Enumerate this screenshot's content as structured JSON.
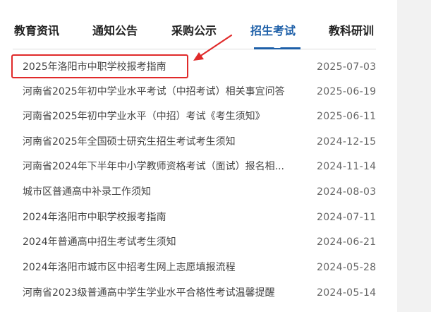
{
  "tabs": [
    {
      "label": "教育资讯"
    },
    {
      "label": "通知公告"
    },
    {
      "label": "采购公示"
    },
    {
      "label": "招生考试"
    },
    {
      "label": "教科研训"
    }
  ],
  "active_tab": "招生考试",
  "news": [
    {
      "title": "2025年洛阳市中职学校报考指南",
      "date": "2025-07-03"
    },
    {
      "title": "河南省2025年初中学业水平考试（中招考试）相关事宜问答",
      "date": "2025-06-19"
    },
    {
      "title": "河南省2025年初中学业水平（中招）考试《考生须知》",
      "date": "2025-06-11"
    },
    {
      "title": "河南省2025年全国硕士研究生招生考试考生须知",
      "date": "2024-12-15"
    },
    {
      "title": "河南省2024年下半年中小学教师资格考试（面试）报名相...",
      "date": "2024-11-14"
    },
    {
      "title": "城市区普通高中补录工作须知",
      "date": "2024-08-03"
    },
    {
      "title": "2024年洛阳市中职学校报考指南",
      "date": "2024-07-11"
    },
    {
      "title": "2024年普通高中招生考试考生须知",
      "date": "2024-06-21"
    },
    {
      "title": "2024年洛阳市城市区中招考生网上志愿填报流程",
      "date": "2024-05-28"
    },
    {
      "title": "河南省2023级普通高中学生学业水平合格性考试温馨提醒",
      "date": "2024-05-14"
    }
  ],
  "colors": {
    "accent": "#1d5fa8",
    "annotation": "#e02a2a",
    "side_panel": "#f2f2f2"
  }
}
